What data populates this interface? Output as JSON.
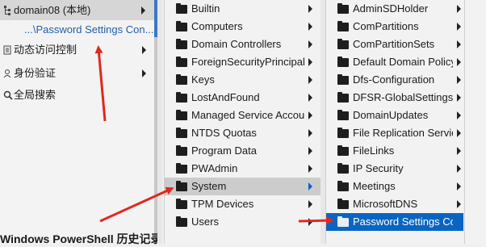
{
  "nav": {
    "domain_label": "domain08 (本地)",
    "child_label": "...\\Password Settings Con...",
    "items": [
      {
        "label": "动态访问控制"
      },
      {
        "label": "身份验证"
      },
      {
        "label": "全局搜索"
      }
    ],
    "bottom_text": "Windows PowerShell 历史记录"
  },
  "menu1": {
    "items": [
      {
        "label": "Builtin",
        "has_submenu": true
      },
      {
        "label": "Computers",
        "has_submenu": true
      },
      {
        "label": "Domain Controllers",
        "has_submenu": true
      },
      {
        "label": "ForeignSecurityPrincipals",
        "has_submenu": true
      },
      {
        "label": "Keys",
        "has_submenu": true
      },
      {
        "label": "LostAndFound",
        "has_submenu": true
      },
      {
        "label": "Managed Service Accounts",
        "has_submenu": true
      },
      {
        "label": "NTDS Quotas",
        "has_submenu": true
      },
      {
        "label": "Program Data",
        "has_submenu": true
      },
      {
        "label": "PWAdmin",
        "has_submenu": true
      },
      {
        "label": "System",
        "has_submenu": true,
        "selected": true
      },
      {
        "label": "TPM Devices",
        "has_submenu": true
      },
      {
        "label": "Users",
        "has_submenu": true
      }
    ]
  },
  "menu2": {
    "items": [
      {
        "label": "AdminSDHolder",
        "has_submenu": true
      },
      {
        "label": "ComPartitions",
        "has_submenu": true
      },
      {
        "label": "ComPartitionSets",
        "has_submenu": true
      },
      {
        "label": "Default Domain Policy",
        "has_submenu": true
      },
      {
        "label": "Dfs-Configuration",
        "has_submenu": true
      },
      {
        "label": "DFSR-GlobalSettings",
        "has_submenu": true
      },
      {
        "label": "DomainUpdates",
        "has_submenu": true
      },
      {
        "label": "File Replication Service",
        "has_submenu": true
      },
      {
        "label": "FileLinks",
        "has_submenu": true
      },
      {
        "label": "IP Security",
        "has_submenu": true
      },
      {
        "label": "Meetings",
        "has_submenu": true
      },
      {
        "label": "MicrosoftDNS",
        "has_submenu": true
      },
      {
        "label": "Password Settings Container",
        "has_submenu": false,
        "selected": true
      }
    ]
  },
  "colors": {
    "selection_blue": "#0a64c2",
    "annotation_red": "#e0281e"
  }
}
